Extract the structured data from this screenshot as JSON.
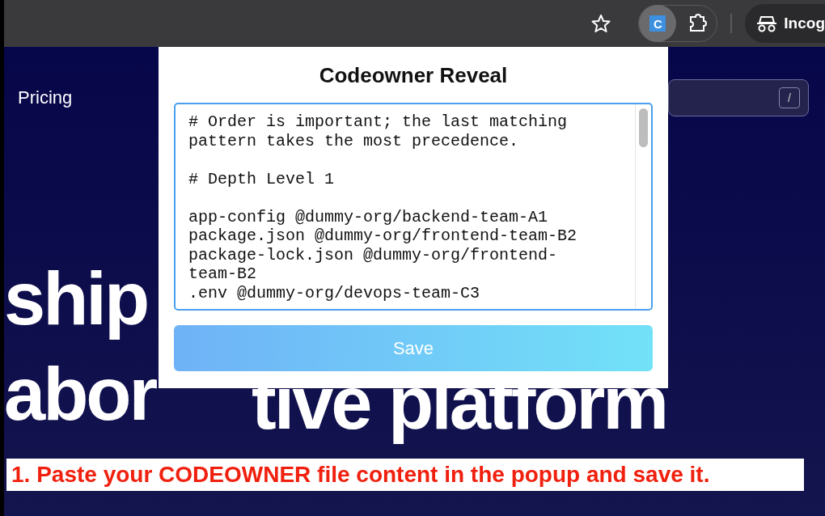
{
  "toolbar": {
    "profile_label": "Incog",
    "extension_letter": "C"
  },
  "page": {
    "nav_item": "Pricing",
    "search_key": "/",
    "headline": [
      "ship",
      "abor",
      "tive platform"
    ]
  },
  "popup": {
    "title": "Codeowner Reveal",
    "content": "# Order is important; the last matching pattern takes the most precedence.\n\n# Depth Level 1\n\napp-config @dummy-org/backend-team-A1\npackage.json @dummy-org/frontend-team-B2\npackage-lock.json @dummy-org/frontend-team-B2\n.env @dummy-org/devops-team-C3",
    "save_label": "Save"
  },
  "caption": "1. Paste your CODEOWNER file content in the popup and save it."
}
